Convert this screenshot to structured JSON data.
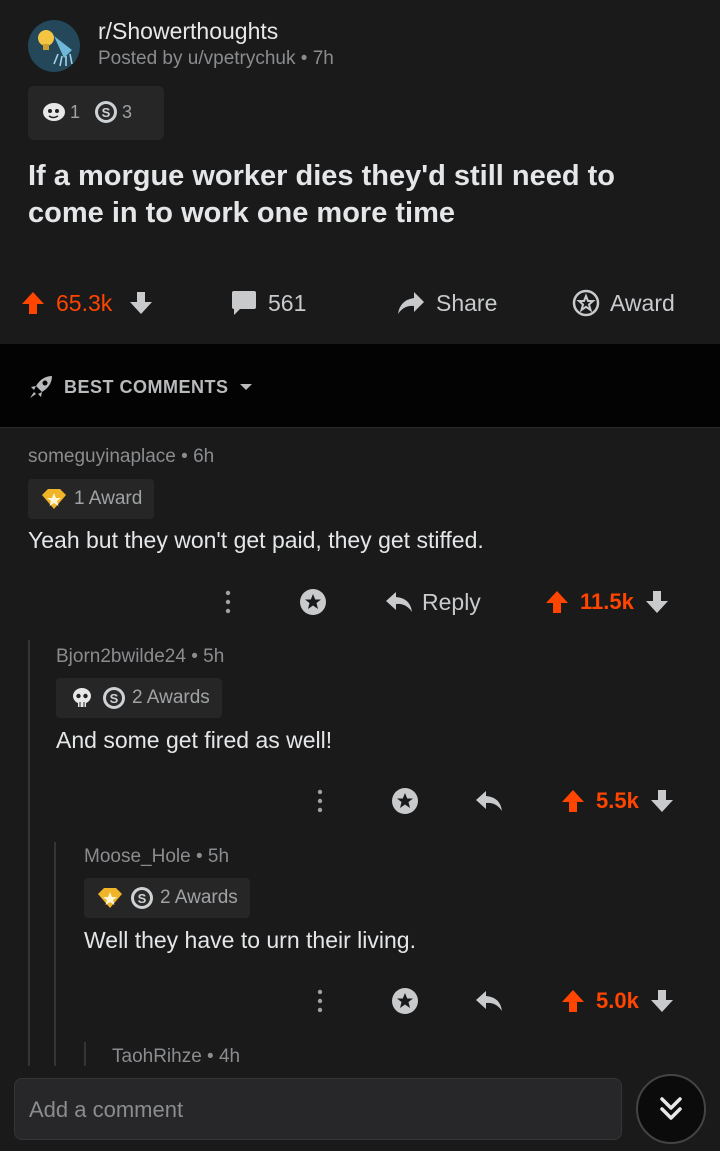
{
  "post": {
    "subreddit": "r/Showerthoughts",
    "posted_by": "Posted by u/vpetrychuk • 7h",
    "award_counts": [
      "1",
      "3"
    ],
    "title": "If a morgue worker dies they'd still need to come in to work one more time",
    "upvotes": "65.3k",
    "comments": "561",
    "share_label": "Share",
    "award_label": "Award"
  },
  "sort": {
    "label": "BEST COMMENTS"
  },
  "comments": [
    {
      "author": "someguyinaplace • 6h",
      "awards": "1 Award",
      "body": "Yeah but they won't get paid, they get stiffed.",
      "reply_label": "Reply",
      "votes": "11.5k"
    },
    {
      "author": "Bjorn2bwilde24 • 5h",
      "awards": "2 Awards",
      "body": "And some get fired as well!",
      "votes": "5.5k"
    },
    {
      "author": "Moose_Hole • 5h",
      "awards": "2 Awards",
      "body": "Well they have to urn their living.",
      "votes": "5.0k"
    },
    {
      "author": "TaohRihze • 4h"
    }
  ],
  "composer": {
    "placeholder": "Add a comment"
  },
  "colors": {
    "accent": "#ff4500",
    "background": "#1a1a1b",
    "text": "#d7dadc",
    "muted": "#8a8c8e"
  },
  "icons": [
    "shower-head-icon",
    "award-icon",
    "upvote-icon",
    "downvote-icon",
    "comment-icon",
    "share-icon",
    "reply-icon",
    "more-icon",
    "rocket-icon",
    "chevron-down-icon",
    "double-chevron-down-icon"
  ]
}
